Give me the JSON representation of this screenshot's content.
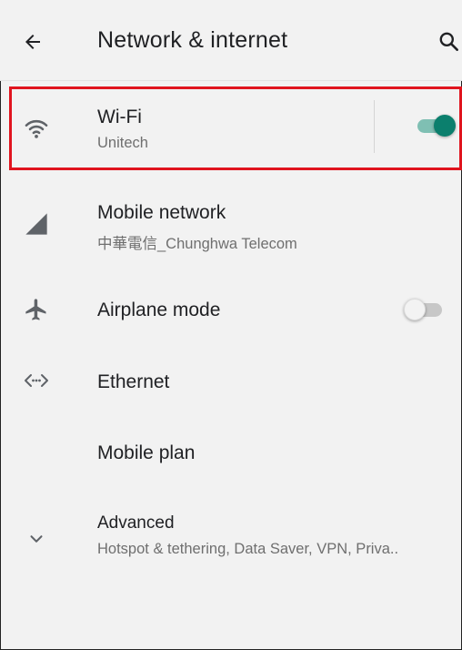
{
  "header": {
    "title": "Network & internet",
    "back_icon": "arrow-back-icon",
    "search_icon": "search-icon"
  },
  "items": {
    "wifi": {
      "title": "Wi-Fi",
      "subtitle": "Unitech",
      "toggle": "on",
      "icon": "wifi-icon"
    },
    "mobile_network": {
      "title": "Mobile network",
      "subtitle": "中華電信_Chunghwa Telecom",
      "icon": "cellular-signal-icon"
    },
    "airplane_mode": {
      "title": "Airplane mode",
      "toggle": "off",
      "icon": "airplane-icon"
    },
    "ethernet": {
      "title": "Ethernet",
      "icon": "ethernet-icon"
    },
    "mobile_plan": {
      "title": "Mobile plan"
    },
    "advanced": {
      "title": "Advanced",
      "subtitle": "Hotspot & tethering, Data Saver, VPN, Priva..",
      "icon": "chevron-down-icon"
    }
  },
  "colors": {
    "accent": "#0b7f6d",
    "highlight_border": "#e0141e",
    "background": "#f2f2f2"
  }
}
